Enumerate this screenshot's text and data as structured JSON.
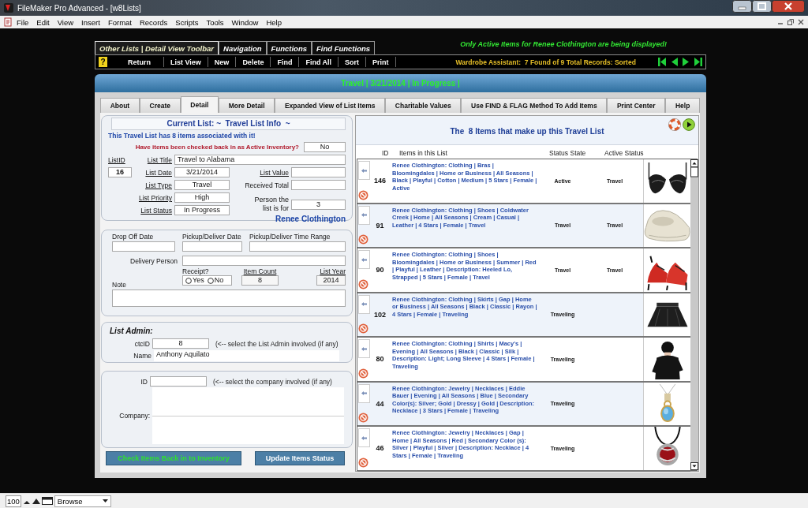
{
  "window": {
    "title": "FileMaker Pro Advanced - [w8Lists]"
  },
  "menu": [
    "File",
    "Edit",
    "View",
    "Insert",
    "Format",
    "Records",
    "Scripts",
    "Tools",
    "Window",
    "Help"
  ],
  "toolbar_tabs": [
    {
      "label": "Other Lists | Detail View Toolbar",
      "selected": true
    },
    {
      "label": "Navigation",
      "selected": false
    },
    {
      "label": "Functions",
      "selected": false
    },
    {
      "label": "Find Functions",
      "selected": false
    }
  ],
  "notice": "Only Active Items for Renee Clothington are being displayed!",
  "toolbar": {
    "help": "?",
    "buttons": [
      "Return",
      "List View",
      "New",
      "Delete",
      "Find",
      "Find All",
      "Sort",
      "Print"
    ],
    "record_status": "Wardrobe Assistant:  7 Found of 9 Total Records: Sorted"
  },
  "header_title": "Travel | 3/21/2014 | In Progress |",
  "tabs": [
    {
      "label": "About",
      "selected": false
    },
    {
      "label": "Create",
      "selected": false
    },
    {
      "label": "Detail",
      "selected": true
    },
    {
      "label": "More Detail",
      "selected": false
    },
    {
      "label": "Expanded View of List Items",
      "selected": false
    },
    {
      "label": "Charitable Values",
      "selected": false
    },
    {
      "label": "Use FIND & FLAG Method To Add Items",
      "selected": false
    },
    {
      "label": "Print Center",
      "selected": false
    },
    {
      "label": "Help",
      "selected": false
    }
  ],
  "list_info": {
    "heading": "Current List: ~  Travel List Info  ~",
    "items_note": "This Travel List has 8 items associated with it!",
    "checked_back": {
      "label": "Have items been checked back in as Active Inventory?",
      "value": "No"
    },
    "list_id": {
      "label": "ListID",
      "value": "16"
    },
    "fields": [
      {
        "label": "List Title",
        "value": "Travel to Alabama"
      },
      {
        "label": "List Date",
        "value": "3/21/2014"
      },
      {
        "label": "List Type",
        "value": "Travel"
      },
      {
        "label": "List Priority",
        "value": "High"
      },
      {
        "label": "List Status",
        "value": "In Progress"
      }
    ],
    "side_fields": [
      {
        "label": "List Value",
        "underlined": true
      },
      {
        "label": "Received Total",
        "underlined": false
      },
      {
        "label": "Person the list is for",
        "underlined": false,
        "value": "3"
      }
    ],
    "person_name": "Renee Clothington"
  },
  "delivery": {
    "drop_off_label": "Drop Off Date",
    "pickup_date_label": "Pickup/Deliver Date",
    "time_range_label": "Pickup/Deliver Time Range",
    "delivery_person_label": "Delivery Person",
    "receipt": {
      "label": "Receipt?",
      "options": [
        {
          "label": "Yes",
          "selected": false
        },
        {
          "label": "No",
          "selected": false
        }
      ]
    },
    "item_count": {
      "label": "Item Count",
      "value": "8"
    },
    "list_year": {
      "label": "List Year",
      "value": "2014"
    },
    "note_label": "Note"
  },
  "list_admin": {
    "title": "List Admin:",
    "id_label": "ctcID",
    "id_value": "8",
    "hint": "(<-- select the List Admin involved (if any)",
    "name_label": "Name",
    "name_value": "Anthony Aquilato"
  },
  "company": {
    "id_label": "ID",
    "hint": "(<-- select the company involved (if any)",
    "company_label": "Company:"
  },
  "buttons": [
    {
      "label": "Check Items Back in to Inventory",
      "kind": "check_in"
    },
    {
      "label": "Update Items Status",
      "kind": "update"
    }
  ],
  "items_panel": {
    "title": "The  8 Items that make up this Travel List",
    "columns": [
      "ID",
      "Items in this List",
      "Status State",
      "Active Status"
    ],
    "rows": [
      {
        "id": "146",
        "description": "Renee Clothington: Clothing | Bras | Bloomingdales | Home or Business | All Seasons | Black | Playful | Cotton | Medium | 5 Stars | Female | Active",
        "status_state": "Active",
        "active_status": "Travel"
      },
      {
        "id": "91",
        "description": "Renee Clothington: Clothing | Shoes | Coldwater Creek | Home | All Seasons | Cream | Casual | Leather | 4 Stars | Female | Travel",
        "status_state": "Travel",
        "active_status": "Travel"
      },
      {
        "id": "90",
        "description": "Renee Clothington: Clothing | Shoes | Bloomingdales | Home or Business | Summer | Red | Playful | Leather | Description: Heeled Lo, Strapped | 5 Stars | Female | Travel",
        "status_state": "Travel",
        "active_status": "Travel"
      },
      {
        "id": "102",
        "description": "Renee Clothington: Clothing | Skirts | Gap | Home or Business | All Seasons | Black | Classic | Rayon | 4 Stars | Female | Traveling",
        "status_state": "Traveling"
      },
      {
        "id": "80",
        "description": "Renee Clothington: Clothing | Shirts | Macy's | Evening | All Seasons | Black | Classic | Silk | Description: Light; Long Sleeve | 4 Stars | Female | Traveling",
        "status_state": "Traveling"
      },
      {
        "id": "44",
        "description": "Renee Clothington: Jewelry | Necklaces | Eddie Bauer | Evening | All Seasons | Blue | Secondary Color(s): Silver; Gold | Dressy | Gold | Description: Necklace | 3 Stars | Female | Traveling",
        "status_state": "Traveling"
      },
      {
        "id": "46",
        "description": "Renee Clothington: Jewelry | Necklaces | Gap | Home | All Seasons | Red | Secondary Color (s): Silver | Playful | Silver | Description: Necklace | 4 Stars | Female | Traveling",
        "status_state": "Traveling"
      }
    ]
  },
  "status_bar": {
    "zoom": "100",
    "mode": "Browse"
  }
}
